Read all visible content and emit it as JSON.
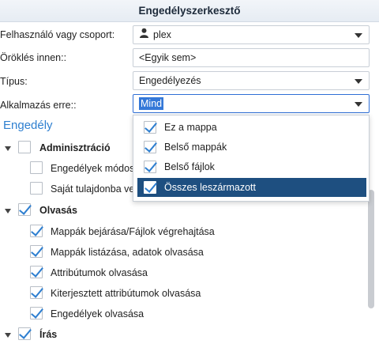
{
  "window": {
    "title": "Engedélyszerkesztő"
  },
  "form": {
    "user_label": "Felhasználó vagy csoport:",
    "user_value": "plex",
    "inherit_label": "Öröklés innen::",
    "inherit_value": "<Egyik sem>",
    "type_label": "Típus:",
    "type_value": "Engedélyezés",
    "apply_label": "Alkalmazás erre::",
    "apply_value": "Mind"
  },
  "apply_dropdown": {
    "options": [
      {
        "label": "Ez a mappa",
        "checked": true
      },
      {
        "label": "Belső mappák",
        "checked": true
      },
      {
        "label": "Belső fájlok",
        "checked": true
      },
      {
        "label": "Összes leszármazott",
        "checked": true,
        "highlighted": true
      }
    ]
  },
  "permissions": {
    "title": "Engedély",
    "groups": [
      {
        "label": "Adminisztráció",
        "checked": false,
        "items": [
          {
            "label": "Engedélyek módos",
            "checked": false
          },
          {
            "label": "Saját tulajdonba ve",
            "checked": false
          }
        ]
      },
      {
        "label": "Olvasás",
        "checked": true,
        "items": [
          {
            "label": "Mappák bejárása/Fájlok végrehajtása",
            "checked": true
          },
          {
            "label": "Mappák listázása, adatok olvasása",
            "checked": true
          },
          {
            "label": "Attribútumok olvasása",
            "checked": true
          },
          {
            "label": "Kiterjesztett attribútumok olvasása",
            "checked": true
          },
          {
            "label": "Engedélyek olvasása",
            "checked": true
          }
        ]
      },
      {
        "label": "Írás",
        "checked": true,
        "items": []
      }
    ]
  },
  "colors": {
    "accent": "#2e7fd0",
    "selection": "#3478d8",
    "highlight_row": "#1e4f80"
  }
}
